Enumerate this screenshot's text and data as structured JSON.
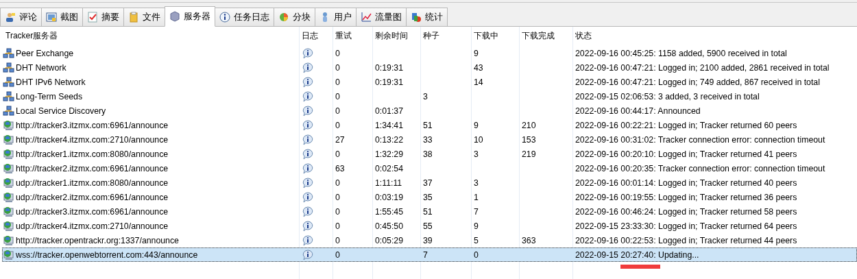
{
  "tabs": [
    {
      "label": "评论",
      "selected": false
    },
    {
      "label": "截图",
      "selected": false
    },
    {
      "label": "摘要",
      "selected": false
    },
    {
      "label": "文件",
      "selected": false
    },
    {
      "label": "服务器",
      "selected": true
    },
    {
      "label": "任务日志",
      "selected": false
    },
    {
      "label": "分块",
      "selected": false
    },
    {
      "label": "用户",
      "selected": false
    },
    {
      "label": "流量图",
      "selected": false
    },
    {
      "label": "统计",
      "selected": false
    }
  ],
  "table": {
    "columns": [
      "Tracker服务器",
      "日志",
      "重试",
      "剩余时间",
      "种子",
      "下载中",
      "下载完成",
      "状态"
    ],
    "rows": [
      {
        "kind": "network",
        "name": "Peer Exchange",
        "retry": "0",
        "remaining": "",
        "seeds": "",
        "downloading": "9",
        "completed": "",
        "status": "2022-09-16 00:45:25: 1158 added, 5900 received in total",
        "selected": false,
        "underlined": false
      },
      {
        "kind": "network",
        "name": "DHT Network",
        "retry": "0",
        "remaining": "0:19:31",
        "seeds": "",
        "downloading": "43",
        "completed": "",
        "status": "2022-09-16 00:47:21: Logged in; 2100 added, 2861 received in total",
        "selected": false,
        "underlined": false
      },
      {
        "kind": "network",
        "name": "DHT IPv6 Network",
        "retry": "0",
        "remaining": "0:19:31",
        "seeds": "",
        "downloading": "14",
        "completed": "",
        "status": "2022-09-16 00:47:21: Logged in; 749 added, 867 received in total",
        "selected": false,
        "underlined": false
      },
      {
        "kind": "network",
        "name": "Long-Term Seeds",
        "retry": "0",
        "remaining": "",
        "seeds": "3",
        "downloading": "",
        "completed": "",
        "status": "2022-09-15 02:06:53: 3 added, 3 received in total",
        "selected": false,
        "underlined": false
      },
      {
        "kind": "network",
        "name": "Local Service Discovery",
        "retry": "0",
        "remaining": "0:01:37",
        "seeds": "",
        "downloading": "",
        "completed": "",
        "status": "2022-09-16 00:44:17: Announced",
        "selected": false,
        "underlined": false
      },
      {
        "kind": "tracker",
        "name": "http://tracker3.itzmx.com:6961/announce",
        "retry": "0",
        "remaining": "1:34:41",
        "seeds": "51",
        "downloading": "9",
        "completed": "210",
        "status": "2022-09-16 00:22:21: Logged in; Tracker returned 60 peers",
        "selected": false,
        "underlined": false
      },
      {
        "kind": "tracker",
        "name": "http://tracker4.itzmx.com:2710/announce",
        "retry": "27",
        "remaining": "0:13:22",
        "seeds": "33",
        "downloading": "10",
        "completed": "153",
        "status": "2022-09-16 00:31:02: Tracker connection error: connection timeout",
        "selected": false,
        "underlined": false
      },
      {
        "kind": "tracker",
        "name": "http://tracker1.itzmx.com:8080/announce",
        "retry": "0",
        "remaining": "1:32:29",
        "seeds": "38",
        "downloading": "3",
        "completed": "219",
        "status": "2022-09-16 00:20:10: Logged in; Tracker returned 41 peers",
        "selected": false,
        "underlined": false
      },
      {
        "kind": "tracker",
        "name": "http://tracker2.itzmx.com:6961/announce",
        "retry": "63",
        "remaining": "0:02:54",
        "seeds": "",
        "downloading": "",
        "completed": "",
        "status": "2022-09-16 00:20:35: Tracker connection error: connection timeout",
        "selected": false,
        "underlined": false
      },
      {
        "kind": "tracker",
        "name": "udp://tracker1.itzmx.com:8080/announce",
        "retry": "0",
        "remaining": "1:11:11",
        "seeds": "37",
        "downloading": "3",
        "completed": "",
        "status": "2022-09-16 00:01:14: Logged in; Tracker returned 40 peers",
        "selected": false,
        "underlined": false
      },
      {
        "kind": "tracker",
        "name": "udp://tracker2.itzmx.com:6961/announce",
        "retry": "0",
        "remaining": "0:03:19",
        "seeds": "35",
        "downloading": "1",
        "completed": "",
        "status": "2022-09-16 00:19:55: Logged in; Tracker returned 36 peers",
        "selected": false,
        "underlined": false
      },
      {
        "kind": "tracker",
        "name": "udp://tracker3.itzmx.com:6961/announce",
        "retry": "0",
        "remaining": "1:55:45",
        "seeds": "51",
        "downloading": "7",
        "completed": "",
        "status": "2022-09-16 00:46:24: Logged in; Tracker returned 58 peers",
        "selected": false,
        "underlined": false
      },
      {
        "kind": "tracker",
        "name": "udp://tracker4.itzmx.com:2710/announce",
        "retry": "0",
        "remaining": "0:45:50",
        "seeds": "55",
        "downloading": "9",
        "completed": "",
        "status": "2022-09-15 23:33:30: Logged in; Tracker returned 64 peers",
        "selected": false,
        "underlined": false
      },
      {
        "kind": "tracker",
        "name": "http://tracker.opentrackr.org:1337/announce",
        "retry": "0",
        "remaining": "0:05:29",
        "seeds": "39",
        "downloading": "5",
        "completed": "363",
        "status": "2022-09-16 00:22:53: Logged in; Tracker returned 44 peers",
        "selected": false,
        "underlined": false
      },
      {
        "kind": "tracker",
        "name": "wss://tracker.openwebtorrent.com:443/announce",
        "retry": "0",
        "remaining": "",
        "seeds": "7",
        "downloading": "0",
        "completed": "",
        "status": "2022-09-15 20:27:40: Updating...",
        "selected": true,
        "underlined": true
      }
    ]
  }
}
